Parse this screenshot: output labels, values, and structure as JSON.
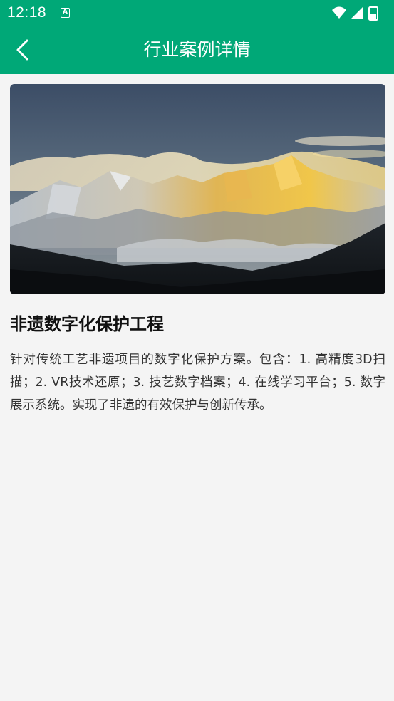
{
  "status_bar": {
    "time": "12:18",
    "notification_icon": "A",
    "icons": [
      "wifi-icon",
      "signal-icon",
      "battery-icon"
    ]
  },
  "header": {
    "title": "行业案例详情",
    "back_icon": "chevron-left-icon"
  },
  "article": {
    "image_subject": "snow-mountain-sunrise",
    "title": "非遗数字化保护工程",
    "description": "针对传统工艺非遗项目的数字化保护方案。包含：1. 高精度3D扫描；2. VR技术还原；3. 技艺数字档案；4. 在线学习平台；5. 数字展示系统。实现了非遗的有效保护与创新传承。"
  },
  "colors": {
    "brand_green": "#00a877",
    "background": "#f4f4f4"
  }
}
